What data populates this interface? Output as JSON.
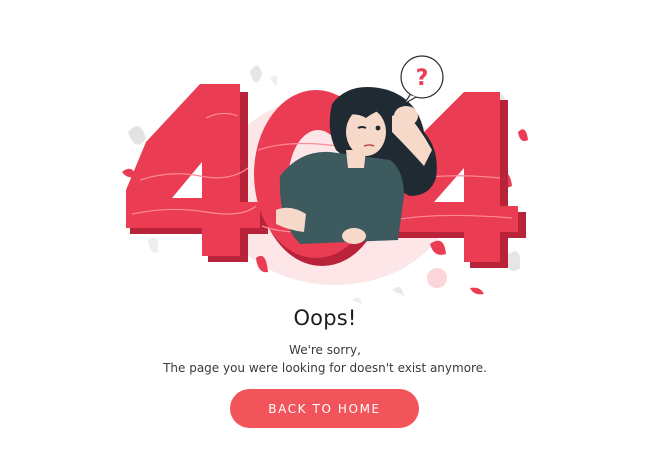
{
  "illustration": {
    "error_code": "404",
    "question_mark": "?"
  },
  "content": {
    "title": "Oops!",
    "line1": "We're sorry,",
    "line2": "The page you were looking for doesn't exist anymore."
  },
  "actions": {
    "back_home_label": "BACK TO HOME"
  },
  "colors": {
    "accent": "#f2545b",
    "digits": "#e8344f",
    "shirt": "#3d5a5e",
    "hair": "#1f2a33"
  }
}
